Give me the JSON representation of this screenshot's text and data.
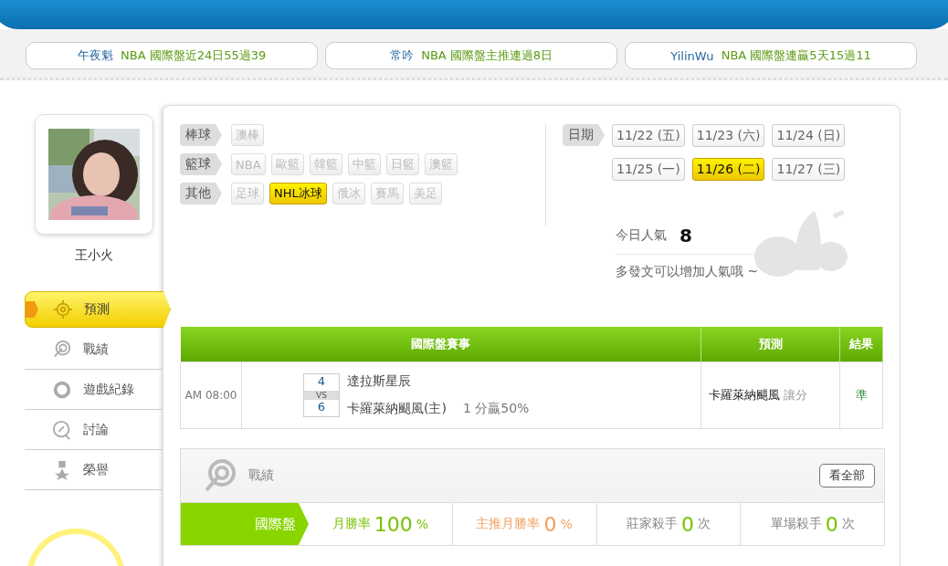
{
  "ticker": [
    {
      "user": "午夜魁",
      "text": "NBA  國際盤近24日55過39"
    },
    {
      "user": "常吟",
      "text": "NBA  國際盤主推連過8日"
    },
    {
      "user": "YilinWu",
      "text": "NBA  國際盤連贏5天15過11"
    }
  ],
  "profile": {
    "name": "王小火"
  },
  "menu": [
    {
      "label": "預測",
      "kind": "predict",
      "selected": true
    },
    {
      "label": "戰績",
      "kind": "record",
      "selected": false
    },
    {
      "label": "遊戲紀錄",
      "kind": "history",
      "selected": false
    },
    {
      "label": "討論",
      "kind": "discuss",
      "selected": false
    },
    {
      "label": "榮譽",
      "kind": "honor",
      "selected": false
    }
  ],
  "sports": [
    {
      "category": "棒球",
      "items": [
        {
          "label": "澳棒",
          "selected": false
        }
      ]
    },
    {
      "category": "籃球",
      "items": [
        {
          "label": "NBA",
          "selected": false
        },
        {
          "label": "歐籃",
          "selected": false
        },
        {
          "label": "韓籃",
          "selected": false
        },
        {
          "label": "中籃",
          "selected": false
        },
        {
          "label": "日籃",
          "selected": false
        },
        {
          "label": "澳籃",
          "selected": false
        }
      ]
    },
    {
      "category": "其他",
      "items": [
        {
          "label": "足球",
          "selected": false
        },
        {
          "label": "NHL冰球",
          "selected": true
        },
        {
          "label": "俄冰",
          "selected": false
        },
        {
          "label": "賽馬",
          "selected": false
        },
        {
          "label": "美足",
          "selected": false
        }
      ]
    }
  ],
  "dates": {
    "label": "日期",
    "items": [
      {
        "label": "11/22 (五)",
        "selected": false
      },
      {
        "label": "11/23 (六)",
        "selected": false
      },
      {
        "label": "11/24 (日)",
        "selected": false
      },
      {
        "label": "11/25 (一)",
        "selected": false
      },
      {
        "label": "11/26 (二)",
        "selected": true
      },
      {
        "label": "11/27 (三)",
        "selected": false
      }
    ]
  },
  "popularity": {
    "label": "今日人氣",
    "value": "8",
    "hint": "多發文可以增加人氣哦 ~"
  },
  "table": {
    "columns": [
      "國際盤賽事",
      "預測",
      "結果"
    ],
    "rows": [
      {
        "time": "AM 08:00",
        "away_score": "4",
        "vs": "VS",
        "home_score": "6",
        "away_team": "達拉斯星辰",
        "home_team": "卡羅萊納颶風(主)",
        "line": "1 分贏50%",
        "pick": "卡羅萊納颶風",
        "pick_type": "讓分",
        "result": "準"
      }
    ]
  },
  "record": {
    "title": "戰績",
    "button": "看全部",
    "tab": "國際盤",
    "stats": [
      {
        "kind": "rate",
        "label": "月勝率",
        "value": "100",
        "unit": "%"
      },
      {
        "kind": "main",
        "label": "主推月勝率",
        "value": "0",
        "unit": "%"
      },
      {
        "kind": "count",
        "label": "莊家殺手",
        "value": "0",
        "unit": "次"
      },
      {
        "kind": "count",
        "label": "單場殺手",
        "value": "0",
        "unit": "次"
      }
    ]
  }
}
